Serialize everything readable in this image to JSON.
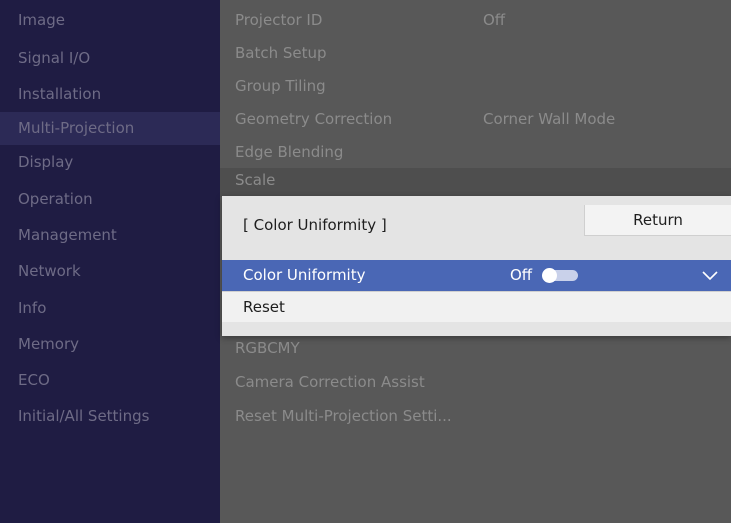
{
  "sidebar": {
    "items": [
      {
        "label": "Image"
      },
      {
        "label": "Signal I/O"
      },
      {
        "label": "Installation"
      },
      {
        "label": "Multi-Projection"
      },
      {
        "label": "Display"
      },
      {
        "label": "Operation"
      },
      {
        "label": "Management"
      },
      {
        "label": "Network"
      },
      {
        "label": "Info"
      },
      {
        "label": "Memory"
      },
      {
        "label": "ECO"
      },
      {
        "label": "Initial/All Settings"
      }
    ],
    "active_index": 3
  },
  "main": {
    "items": [
      {
        "label": "Projector ID",
        "value": "Off"
      },
      {
        "label": "Batch Setup",
        "value": ""
      },
      {
        "label": "Group Tiling",
        "value": ""
      },
      {
        "label": "Geometry Correction",
        "value": "Corner Wall Mode"
      },
      {
        "label": "Edge Blending",
        "value": ""
      },
      {
        "label": "Scale",
        "value": ""
      },
      {
        "label": "RGBCMY",
        "value": ""
      },
      {
        "label": "Camera Correction Assist",
        "value": ""
      },
      {
        "label": "Reset Multi-Projection Setti...",
        "value": ""
      }
    ]
  },
  "dialog": {
    "title": "[ Color Uniformity ]",
    "return_label": "Return",
    "rows": [
      {
        "label": "Color Uniformity",
        "value": "Off",
        "toggle_on": false
      },
      {
        "label": "Reset"
      }
    ]
  },
  "colors": {
    "sidebar_bg": "#1f1c43",
    "sidebar_active_bg": "#2c2a56",
    "main_bg": "#585858",
    "dialog_bg": "#e4e4e4",
    "selection": "#4a67b5"
  }
}
